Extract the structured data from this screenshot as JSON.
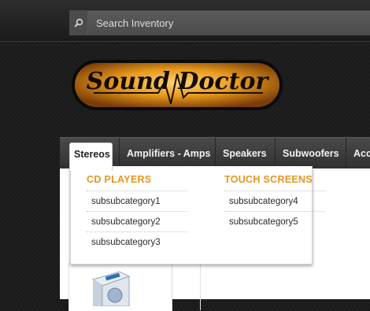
{
  "search": {
    "placeholder": "Search Inventory",
    "value": ""
  },
  "logo": {
    "text": "Sound Doctor"
  },
  "menu": {
    "items": [
      {
        "label": "Stereos",
        "active": true
      },
      {
        "label": "Amplifiers - Amps"
      },
      {
        "label": "Speakers"
      },
      {
        "label": "Subwoofers"
      },
      {
        "label": "Acc"
      }
    ]
  },
  "dropdown": {
    "columns": [
      {
        "heading": "CD PLAYERS",
        "items": [
          "subsubcategory1",
          "subsubcategory2",
          "subsubcategory3"
        ]
      },
      {
        "heading": "TOUCH SCREENS",
        "items": [
          "subsubcategory4",
          "subsubcategory5"
        ]
      }
    ]
  },
  "colors": {
    "accent": "#e8961e",
    "menubar": "#3c3c3c",
    "background": "#1c1c1c"
  },
  "icons": {
    "search": "search-icon"
  }
}
